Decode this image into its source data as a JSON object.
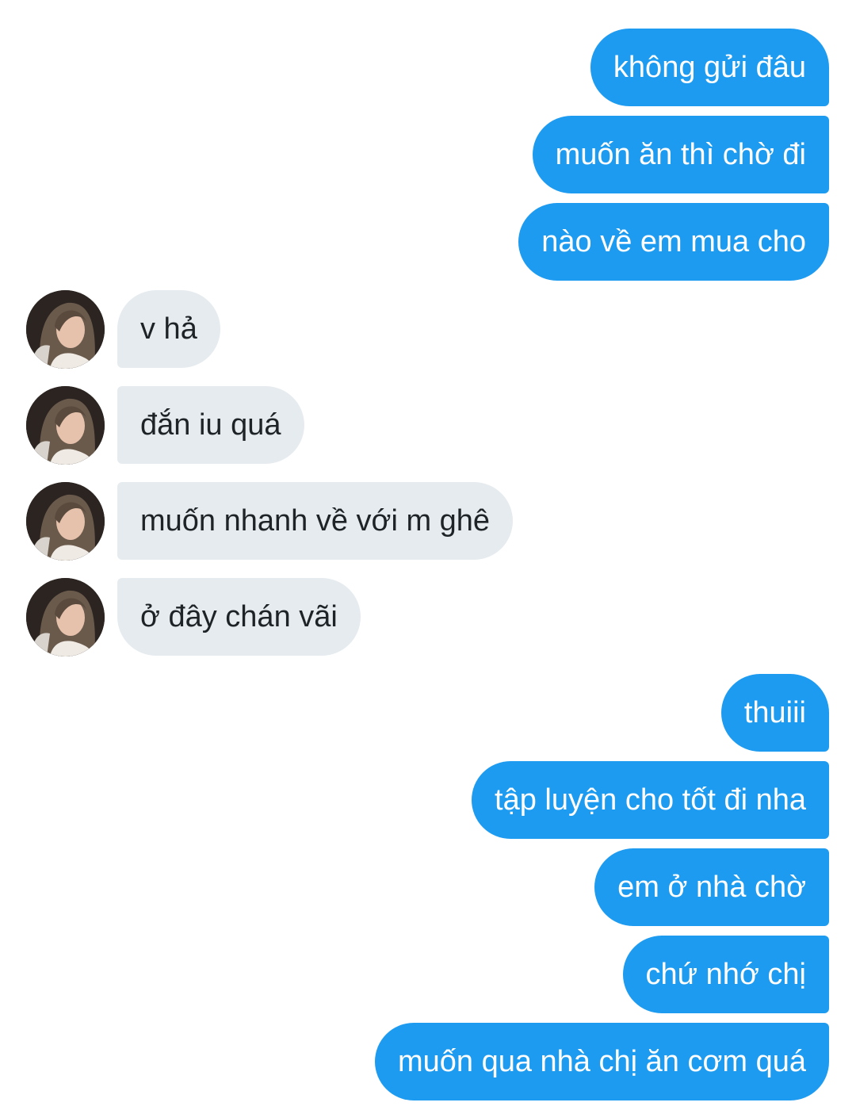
{
  "conversation": {
    "messages": [
      {
        "side": "sent",
        "text": "không gửi đâu"
      },
      {
        "side": "sent",
        "text": "muốn ăn thì chờ đi"
      },
      {
        "side": "sent",
        "text": "nào về em mua cho"
      },
      {
        "side": "received",
        "text": "v hả"
      },
      {
        "side": "received",
        "text": "đắn iu quá"
      },
      {
        "side": "received",
        "text": "muốn nhanh về với m ghê"
      },
      {
        "side": "received",
        "text": "ở đây chán vãi"
      },
      {
        "side": "sent",
        "text": "thuiii"
      },
      {
        "side": "sent",
        "text": "tập luyện cho tốt đi nha"
      },
      {
        "side": "sent",
        "text": "em ở nhà chờ"
      },
      {
        "side": "sent",
        "text": "chứ nhớ chị"
      },
      {
        "side": "sent",
        "text": "muốn qua nhà chị ăn cơm quá"
      }
    ]
  },
  "colors": {
    "sent_bubble": "#1d9bf0",
    "sent_text": "#ffffff",
    "received_bubble": "#e6ebef",
    "received_text": "#1e2328",
    "background": "#ffffff"
  },
  "icons": {
    "avatar": "contact-avatar-photo"
  }
}
